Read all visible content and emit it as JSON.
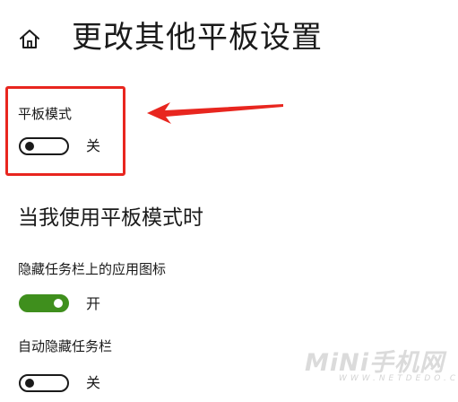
{
  "header": {
    "home_icon": "home-icon",
    "title": "更改其他平板设置"
  },
  "tablet_mode": {
    "label": "平板模式",
    "toggle_state": "off",
    "state_text": "关"
  },
  "section": {
    "heading": "当我使用平板模式时"
  },
  "hide_taskbar_icons": {
    "label": "隐藏任务栏上的应用图标",
    "toggle_state": "on",
    "state_text": "开"
  },
  "auto_hide_taskbar": {
    "label": "自动隐藏任务栏",
    "toggle_state": "off",
    "state_text": "关"
  },
  "annotation": {
    "highlight_color": "#e8261f",
    "arrow_color": "#e8261f"
  },
  "colors": {
    "toggle_on": "#3f8f1d",
    "toggle_off_border": "#1a1a1a"
  },
  "watermark": {
    "main": "MiNi手机网",
    "sub": "WWW.NETDEDO.COM"
  }
}
